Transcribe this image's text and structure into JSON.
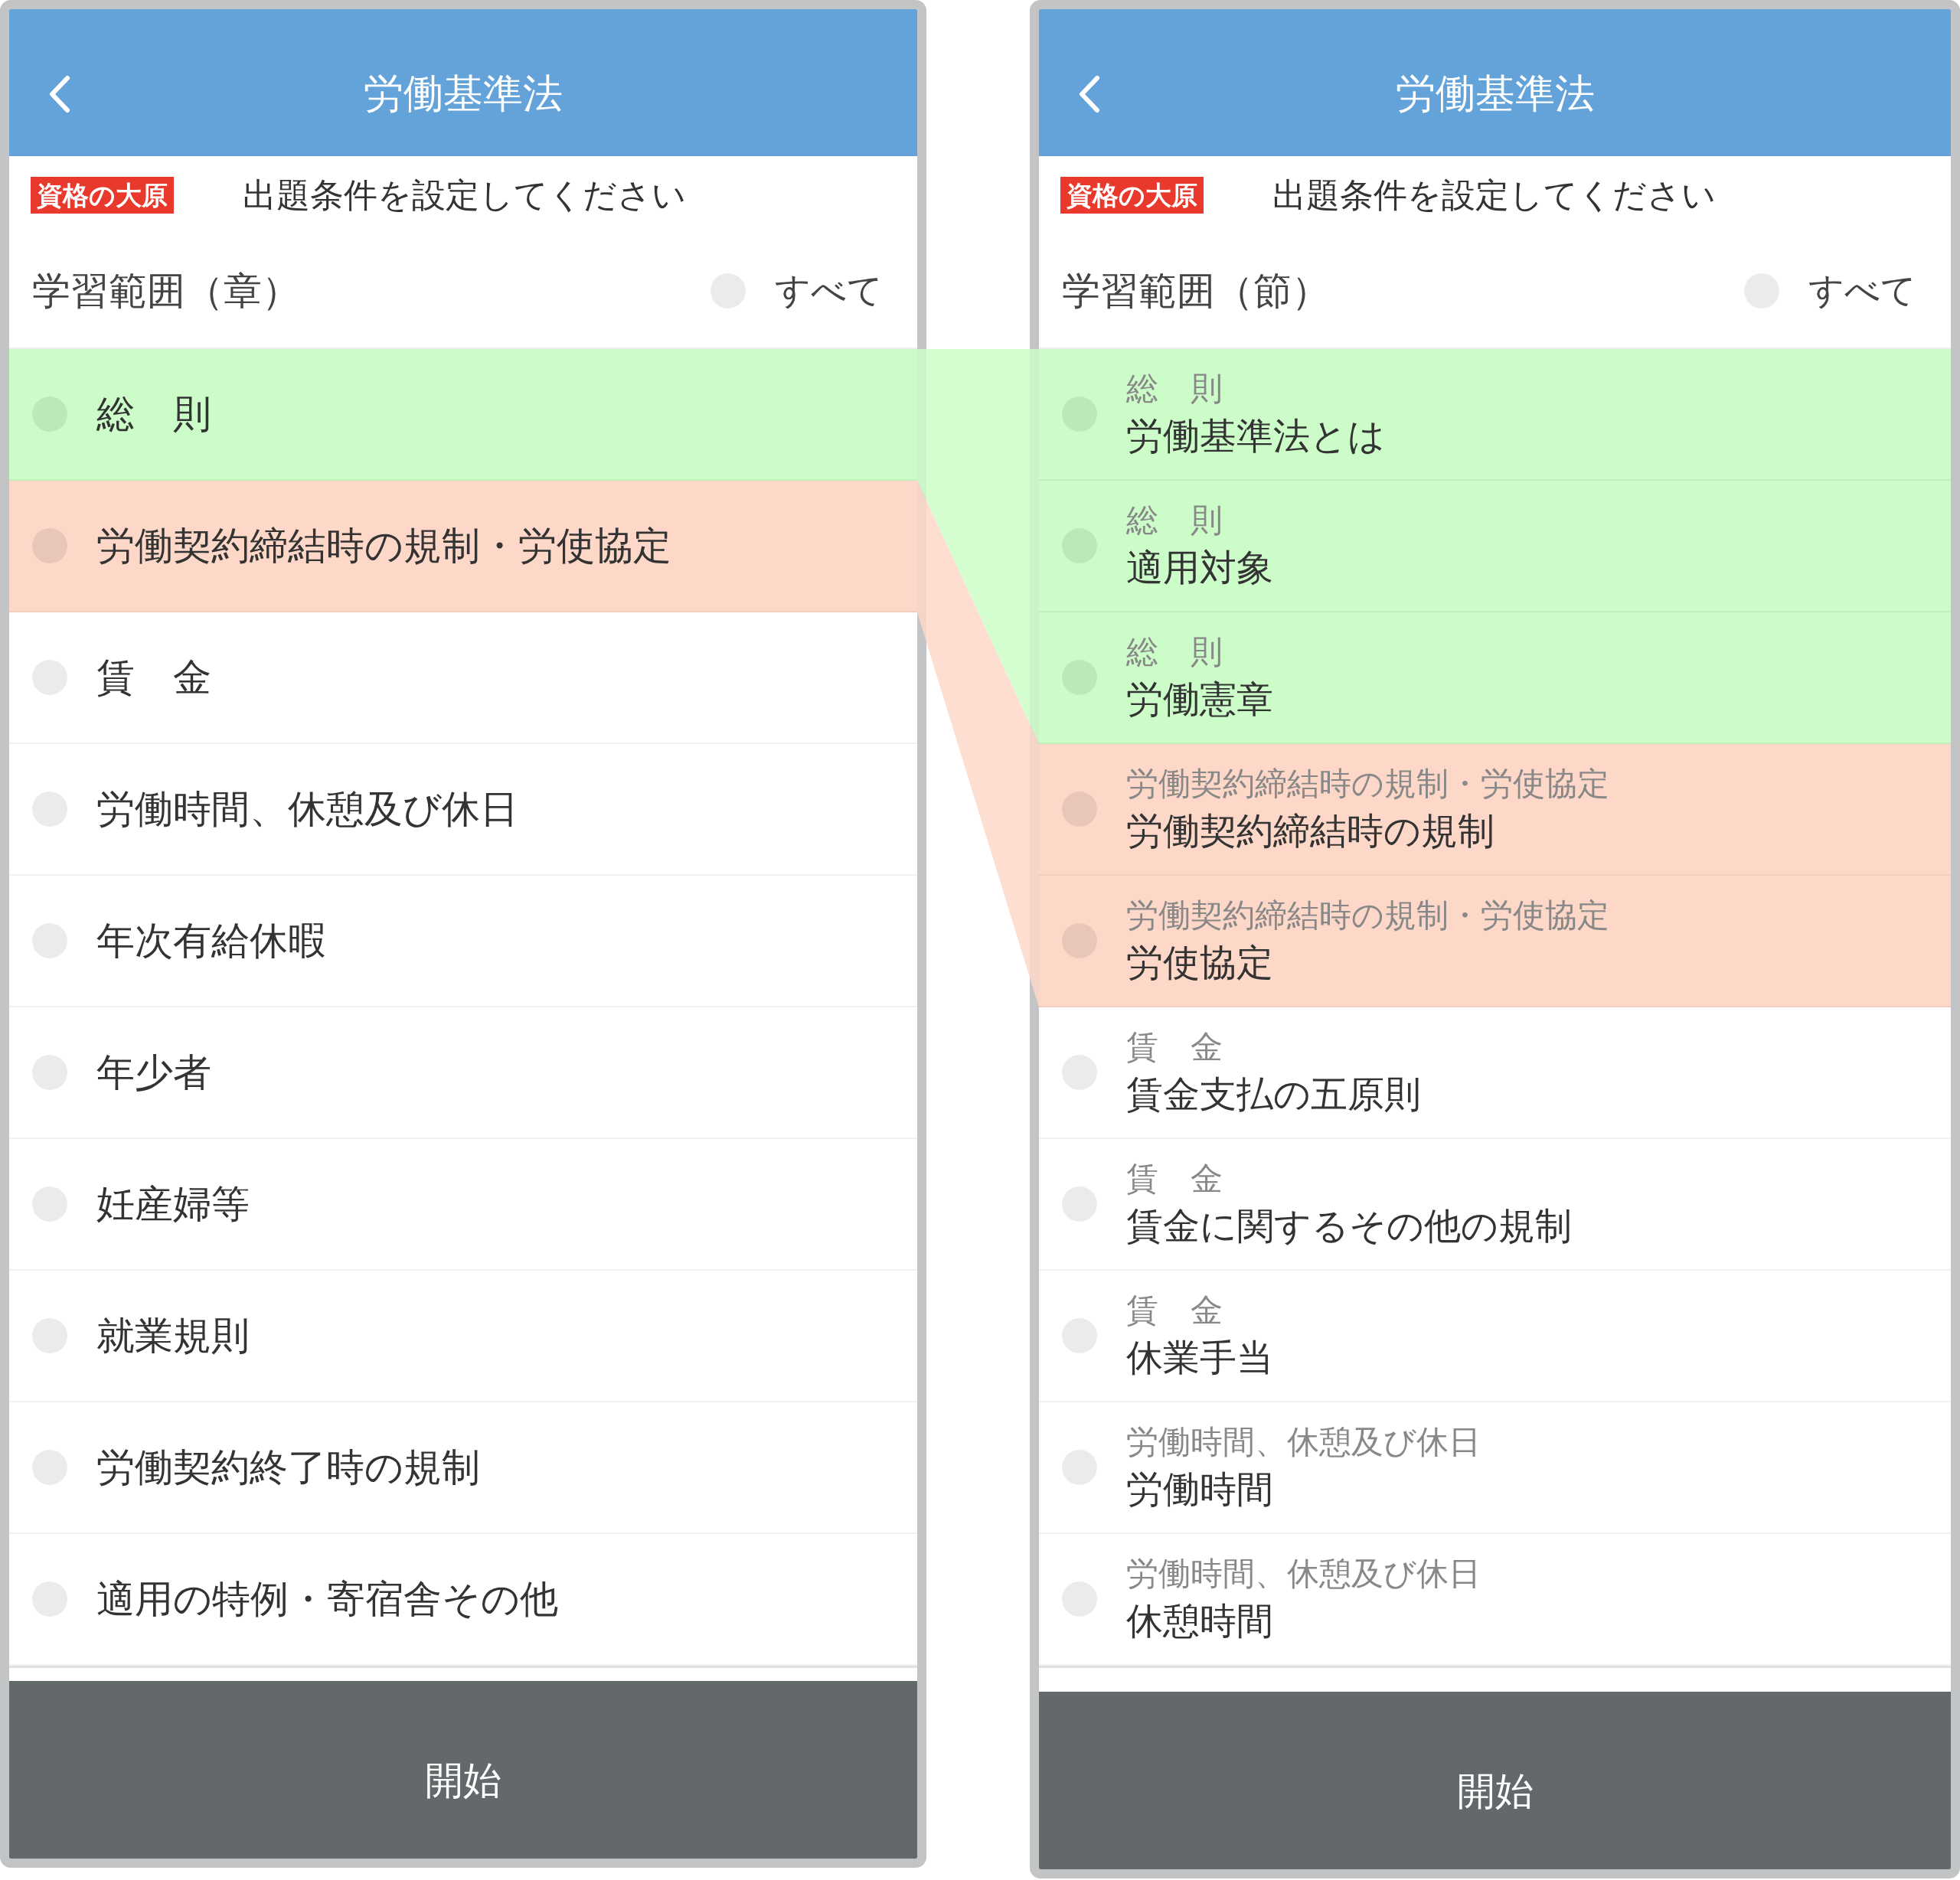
{
  "screens": [
    {
      "title": "労働基準法",
      "logo": "資格の大原",
      "prompt": "出題条件を設定してください",
      "range_label": "学習範囲（章）",
      "select_all": {
        "label": "すべて",
        "selected": false
      },
      "rows": [
        {
          "kind": "chapter",
          "label": "総　則",
          "selected": false,
          "color": "#ccfdc8"
        },
        {
          "kind": "chapter",
          "label": "労働契約締結時の規制・労使協定",
          "selected": false,
          "color": "#fdd8c8"
        },
        {
          "kind": "chapter",
          "label": "賃　金",
          "selected": false
        },
        {
          "kind": "chapter",
          "label": "労働時間、休憩及び休日",
          "selected": false
        },
        {
          "kind": "chapter",
          "label": "年次有給休暇",
          "selected": false
        },
        {
          "kind": "chapter",
          "label": "年少者",
          "selected": false
        },
        {
          "kind": "chapter",
          "label": "妊産婦等",
          "selected": false
        },
        {
          "kind": "chapter",
          "label": "就業規則",
          "selected": false
        },
        {
          "kind": "chapter",
          "label": "労働契約終了時の規制",
          "selected": false
        },
        {
          "kind": "chapter",
          "label": "適用の特例・寄宿舎その他",
          "selected": false
        }
      ],
      "start_button": "開始"
    },
    {
      "title": "労働基準法",
      "logo": "資格の大原",
      "prompt": "出題条件を設定してください",
      "range_label": "学習範囲（節）",
      "select_all": {
        "label": "すべて",
        "selected": false
      },
      "rows": [
        {
          "kind": "section",
          "chapter": "総　則",
          "label": "労働基準法とは",
          "selected": false,
          "color": "#ccfdc8"
        },
        {
          "kind": "section",
          "chapter": "総　則",
          "label": "適用対象",
          "selected": false,
          "color": "#ccfdc8"
        },
        {
          "kind": "section",
          "chapter": "総　則",
          "label": "労働憲章",
          "selected": false,
          "color": "#ccfdc8"
        },
        {
          "kind": "section",
          "chapter": "労働契約締結時の規制・労使協定",
          "label": "労働契約締結時の規制",
          "selected": false,
          "color": "#fdd8c8"
        },
        {
          "kind": "section",
          "chapter": "労働契約締結時の規制・労使協定",
          "label": "労使協定",
          "selected": false,
          "color": "#fdd8c8"
        },
        {
          "kind": "section",
          "chapter": "賃　金",
          "label": "賃金支払の五原則",
          "selected": false
        },
        {
          "kind": "section",
          "chapter": "賃　金",
          "label": "賃金に関するその他の規制",
          "selected": false
        },
        {
          "kind": "section",
          "chapter": "賃　金",
          "label": "休業手当",
          "selected": false
        },
        {
          "kind": "section",
          "chapter": "労働時間、休憩及び休日",
          "label": "労働時間",
          "selected": false
        },
        {
          "kind": "section",
          "chapter": "労働時間、休憩及び休日",
          "label": "休憩時間",
          "selected": false
        }
      ],
      "start_button": "開始"
    }
  ]
}
